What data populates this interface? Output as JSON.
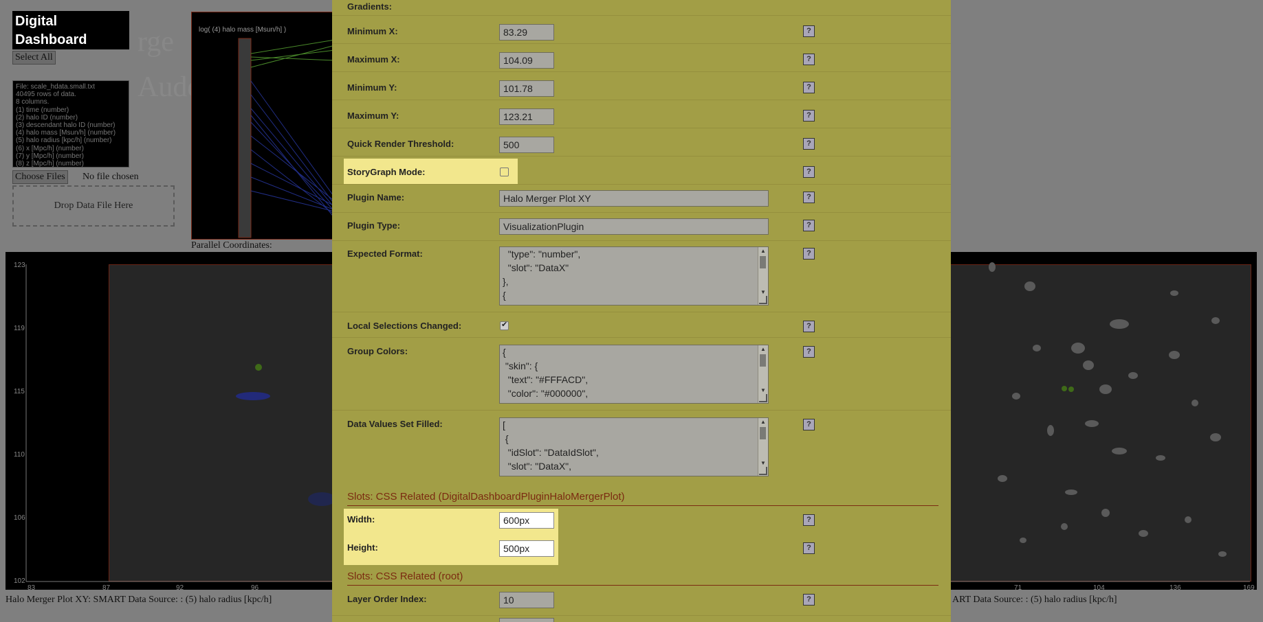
{
  "dashboard": {
    "logo": "Digital Dashboard",
    "select_all_label": "Select All",
    "info_lines": [
      "File: scale_hdata.small.txt",
      "40495 rows of data.",
      "8 columns.",
      "(1) time (number)",
      "(2) halo ID (number)",
      "(3) descendant halo ID (number)",
      "(4) halo mass [Msun/h] (number)",
      "(5) halo radius [kpc/h] (number)",
      "(6) x [Mpc/h] (number)",
      "(7) y [Mpc/h] (number)",
      "(8) z [Mpc/h] (number)"
    ],
    "choose_files_label": "Choose Files",
    "no_file_text": "No file chosen",
    "drop_zone_text": "Drop Data File Here",
    "parallel_axis_label": "log(  (4) halo mass [Msun/h] )",
    "parallel_caption": "Parallel Coordinates:",
    "scatter_left_caption": "Halo Merger Plot XY: SMART Data Source: : (5) halo radius [kpc/h]",
    "scatter_right_caption": "ART Data Source: : (5) halo radius [kpc/h]",
    "y_ticks": [
      "123",
      "119",
      "115",
      "110",
      "106",
      "102"
    ],
    "x_ticks_left": [
      "83",
      "87",
      "92",
      "96"
    ],
    "x_ticks_right": [
      "71",
      "104",
      "136",
      "169"
    ]
  },
  "modal": {
    "rows": {
      "gradients": {
        "label": "Gradients:"
      },
      "min_x": {
        "label": "Minimum X:",
        "value": "83.29"
      },
      "max_x": {
        "label": "Maximum X:",
        "value": "104.09"
      },
      "min_y": {
        "label": "Minimum Y:",
        "value": "101.78"
      },
      "max_y": {
        "label": "Maximum Y:",
        "value": "123.21"
      },
      "quick_render": {
        "label": "Quick Render Threshold:",
        "value": "500"
      },
      "storygraph": {
        "label": "StoryGraph Mode:",
        "checked": false
      },
      "plugin_name": {
        "label": "Plugin Name:",
        "value": "Halo Merger Plot XY"
      },
      "plugin_type": {
        "label": "Plugin Type:",
        "value": "VisualizationPlugin"
      },
      "expected_format": {
        "label": "Expected Format:",
        "lines": [
          "  \"type\": \"number\",",
          "  \"slot\": \"DataX\"",
          "},",
          "{"
        ]
      },
      "local_selections": {
        "label": "Local Selections Changed:",
        "checked": true
      },
      "group_colors": {
        "label": "Group Colors:",
        "lines": [
          "{",
          " \"skin\": {",
          "  \"text\": \"#FFFACD\",",
          "  \"color\": \"#000000\","
        ]
      },
      "data_values": {
        "label": "Data Values Set Filled:",
        "lines": [
          "[",
          " {",
          "  \"idSlot\": \"DataIdSlot\",",
          "  \"slot\": \"DataX\","
        ]
      },
      "width": {
        "label": "Width:",
        "value": "600px"
      },
      "height": {
        "label": "Height:",
        "value": "500px"
      },
      "layer_order": {
        "label": "Layer Order Index:",
        "value": "10"
      }
    },
    "section_css_plugin": "Slots: CSS Related (DigitalDashboardPluginHaloMergerPlot)",
    "section_css_root": "Slots: CSS Related (root)",
    "help_glyph": "?"
  },
  "colors": {
    "modal_bg": "#a29e46",
    "highlight": "#f2e78d",
    "section_text": "#7b2a10"
  }
}
